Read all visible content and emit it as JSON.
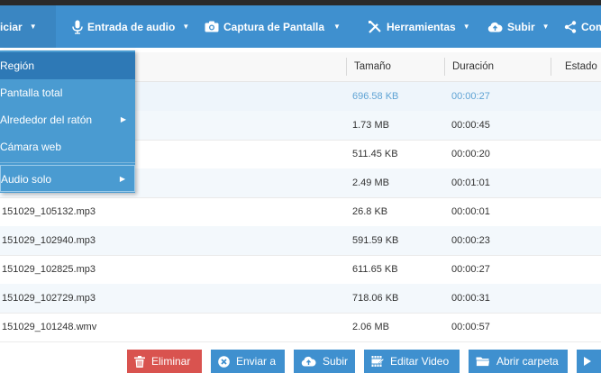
{
  "toolbar": {
    "record_label": "iciar",
    "audio_input_label": "Entrada de audio",
    "screenshot_label": "Captura de Pantalla",
    "tools_label": "Herramientas",
    "upload_label": "Subir",
    "share_label": "Com",
    "dropdown_arrow": "▼"
  },
  "record_menu": {
    "items": [
      {
        "label": "Región"
      },
      {
        "label": "Pantalla total"
      },
      {
        "label": "Alrededor del ratón",
        "submenu": "▶"
      },
      {
        "label": "Cámara web"
      },
      {
        "label": "Audio solo",
        "submenu": "▶"
      }
    ]
  },
  "table": {
    "columns": {
      "size": "Tamaño",
      "duration": "Duración",
      "status": "Estado"
    },
    "rows": [
      {
        "name": "",
        "size": "696.58 KB",
        "duration": "00:00:27"
      },
      {
        "name": "",
        "size": "1.73 MB",
        "duration": "00:00:45"
      },
      {
        "name": "",
        "size": "511.45 KB",
        "duration": "00:00:20"
      },
      {
        "name": "",
        "size": "2.49 MB",
        "duration": "00:01:01"
      },
      {
        "name": "151029_105132.mp3",
        "size": "26.8 KB",
        "duration": "00:00:01"
      },
      {
        "name": "151029_102940.mp3",
        "size": "591.59 KB",
        "duration": "00:00:23"
      },
      {
        "name": "151029_102825.mp3",
        "size": "611.65 KB",
        "duration": "00:00:27"
      },
      {
        "name": "151029_102729.mp3",
        "size": "718.06 KB",
        "duration": "00:00:31"
      },
      {
        "name": "151029_101248.wmv",
        "size": "2.06 MB",
        "duration": "00:00:57"
      }
    ]
  },
  "actions": {
    "delete_label": "Eliminar",
    "send_label": "Enviar a",
    "upload_label": "Subir",
    "edit_video_label": "Editar Video",
    "open_folder_label": "Abrir carpeta"
  },
  "colors": {
    "toolbar": "#3f90cf",
    "dropdown": "#4a9bd1",
    "dropdown_highlight": "#2e79b6",
    "delete_button": "#d9534f",
    "action_button": "#3f90cf",
    "selected_text": "#5fa3d4"
  }
}
